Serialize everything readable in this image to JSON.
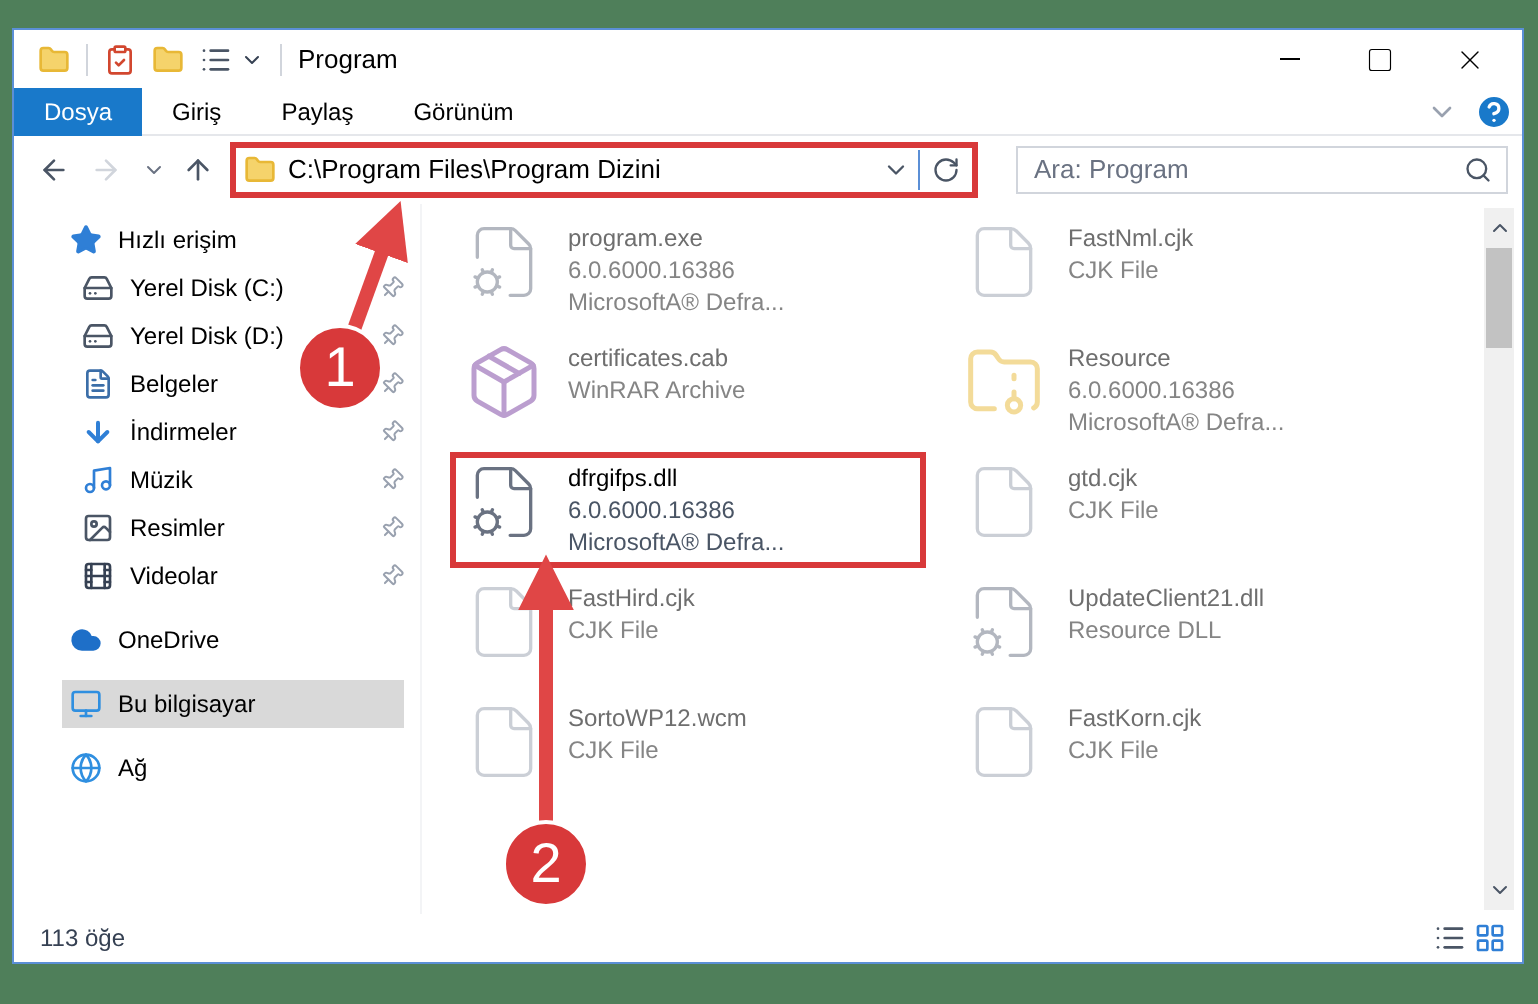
{
  "window": {
    "title": "Program"
  },
  "ribbon_tabs": [
    {
      "label": "Dosya",
      "selected": true
    },
    {
      "label": "Giriş",
      "selected": false
    },
    {
      "label": "Paylaş",
      "selected": false
    },
    {
      "label": "Görünüm",
      "selected": false
    }
  ],
  "address": {
    "path": "C:\\Program Files\\Program Dizini",
    "highlighted": true
  },
  "search": {
    "placeholder": "Ara: Program"
  },
  "sidebar": {
    "items": [
      {
        "label": "Hızlı erişim",
        "kind": "star",
        "selected": false,
        "children": [
          {
            "label": "Yerel Disk (C:)",
            "kind": "disk",
            "pinned": true,
            "selected": false
          },
          {
            "label": "Yerel Disk (D:)",
            "kind": "disk",
            "pinned": true,
            "selected": false
          },
          {
            "label": "Belgeler",
            "kind": "document",
            "pinned": true,
            "selected": false
          },
          {
            "label": "İndirmeler",
            "kind": "download",
            "pinned": true,
            "selected": false
          },
          {
            "label": "Müzik",
            "kind": "music",
            "pinned": true,
            "selected": false
          },
          {
            "label": "Resimler",
            "kind": "picture",
            "pinned": true,
            "selected": false
          },
          {
            "label": "Videolar",
            "kind": "video",
            "pinned": true,
            "selected": false
          }
        ]
      },
      {
        "label": "OneDrive",
        "kind": "cloud",
        "selected": false
      },
      {
        "label": "Bu bilgisayar",
        "kind": "computer",
        "selected": true
      },
      {
        "label": "Ağ",
        "kind": "network",
        "selected": false
      }
    ]
  },
  "files": [
    {
      "name": "program.exe",
      "details": [
        "6.0.6000.16386",
        "MicrosoftA® Defra..."
      ],
      "kind": "exe",
      "dimmed": true,
      "highlighted": false
    },
    {
      "name": "FastNml.cjk",
      "details": [
        "CJK File"
      ],
      "kind": "blank",
      "dimmed": true,
      "highlighted": false
    },
    {
      "name": "certificates.cab",
      "details": [
        "WinRAR Archive"
      ],
      "kind": "archive",
      "dimmed": true,
      "highlighted": false
    },
    {
      "name": "Resource",
      "details": [
        "6.0.6000.16386",
        "MicrosoftA® Defra..."
      ],
      "kind": "zip-folder",
      "dimmed": true,
      "highlighted": false
    },
    {
      "name": "dfrgifps.dll",
      "details": [
        "6.0.6000.16386",
        "MicrosoftA® Defra..."
      ],
      "kind": "dll",
      "dimmed": false,
      "highlighted": true
    },
    {
      "name": "gtd.cjk",
      "details": [
        "CJK File"
      ],
      "kind": "blank",
      "dimmed": true,
      "highlighted": false
    },
    {
      "name": "FastHird.cjk",
      "details": [
        "CJK File"
      ],
      "kind": "blank",
      "dimmed": true,
      "highlighted": false
    },
    {
      "name": "UpdateClient21.dll",
      "details": [
        "Resource DLL"
      ],
      "kind": "dll",
      "dimmed": true,
      "highlighted": false
    },
    {
      "name": "SortoWP12.wcm",
      "details": [
        "CJK File"
      ],
      "kind": "blank",
      "dimmed": true,
      "highlighted": false
    },
    {
      "name": "FastKorn.cjk",
      "details": [
        "CJK File"
      ],
      "kind": "blank",
      "dimmed": true,
      "highlighted": false
    }
  ],
  "status_bar": {
    "item_count": "113 öğe"
  },
  "annotations": [
    {
      "label": "1"
    },
    {
      "label": "2"
    }
  ]
}
